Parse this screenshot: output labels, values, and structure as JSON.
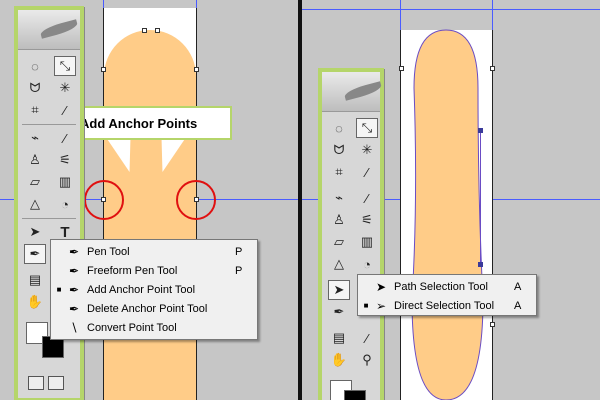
{
  "left_panel": {
    "callout": {
      "label": "Add Anchor Points"
    },
    "pen_flyout": {
      "items": [
        {
          "label": "Pen Tool",
          "shortcut": "P",
          "selected": false,
          "icon": "pen-icon"
        },
        {
          "label": "Freeform Pen Tool",
          "shortcut": "P",
          "selected": false,
          "icon": "freeform-pen-icon"
        },
        {
          "label": "Add Anchor Point Tool",
          "shortcut": "",
          "selected": true,
          "icon": "add-anchor-icon"
        },
        {
          "label": "Delete Anchor Point Tool",
          "shortcut": "",
          "selected": false,
          "icon": "delete-anchor-icon"
        },
        {
          "label": "Convert Point Tool",
          "shortcut": "",
          "selected": false,
          "icon": "convert-point-icon"
        }
      ]
    },
    "toolbox": {
      "type_tool_glyph": "T"
    }
  },
  "right_panel": {
    "selection_flyout": {
      "items": [
        {
          "label": "Path Selection Tool",
          "shortcut": "A",
          "selected": false,
          "icon": "path-selection-icon"
        },
        {
          "label": "Direct Selection Tool",
          "shortcut": "A",
          "selected": true,
          "icon": "direct-selection-icon"
        }
      ]
    }
  },
  "colors": {
    "shape_fill": "#ffcc88",
    "guide": "#4a5cff",
    "highlight_ring": "#e01010",
    "toolbox_border": "#b5d56a",
    "background": "#c6c6c6"
  }
}
